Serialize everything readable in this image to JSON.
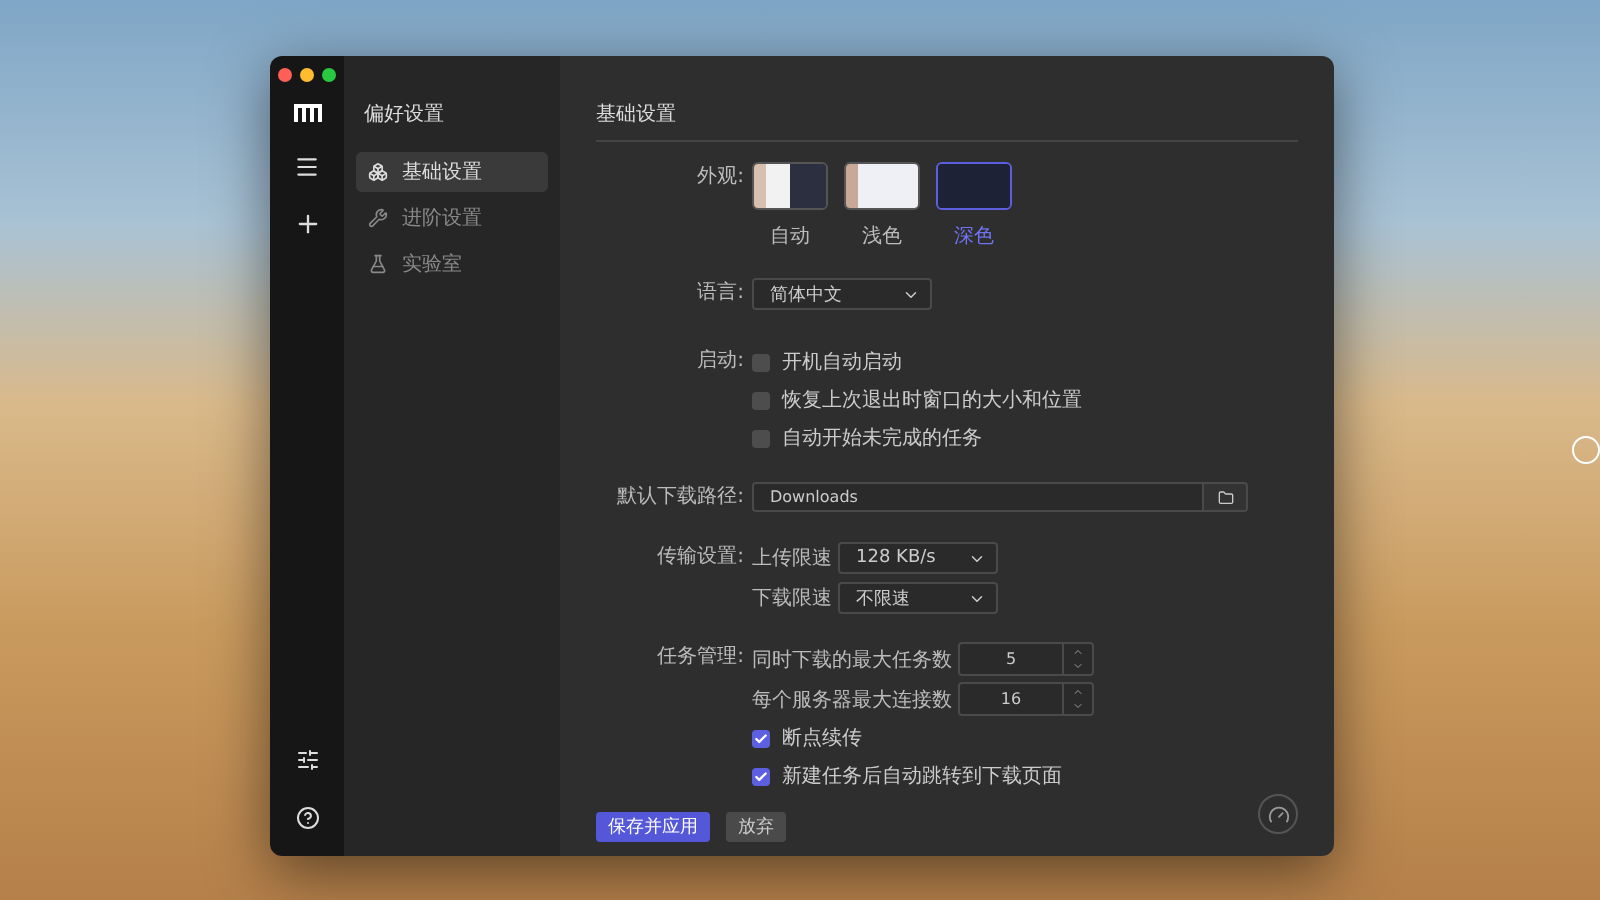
{
  "sidebar": {
    "title": "偏好设置",
    "items": [
      {
        "label": "基础设置",
        "selected": true
      },
      {
        "label": "进阶设置",
        "selected": false
      },
      {
        "label": "实验室",
        "selected": false
      }
    ]
  },
  "main": {
    "title": "基础设置",
    "appearance": {
      "label": "外观:",
      "themes": [
        {
          "kind": "auto",
          "label": "自动",
          "selected": false
        },
        {
          "kind": "light",
          "label": "浅色",
          "selected": false
        },
        {
          "kind": "dark",
          "label": "深色",
          "selected": true
        }
      ]
    },
    "language": {
      "label": "语言:",
      "value": "简体中文"
    },
    "startup": {
      "label": "启动:",
      "options": [
        {
          "label": "开机自动启动",
          "checked": false
        },
        {
          "label": "恢复上次退出时窗口的大小和位置",
          "checked": false
        },
        {
          "label": "自动开始未完成的任务",
          "checked": false
        }
      ]
    },
    "download_path": {
      "label": "默认下载路径:",
      "value": "Downloads"
    },
    "transfer": {
      "label": "传输设置:",
      "limits": [
        {
          "label": "上传限速",
          "value": "128 KB/s"
        },
        {
          "label": "下载限速",
          "value": "不限速"
        }
      ]
    },
    "tasks": {
      "label": "任务管理:",
      "numbers": [
        {
          "label": "同时下载的最大任务数",
          "value": "5"
        },
        {
          "label": "每个服务器最大连接数",
          "value": "16"
        }
      ],
      "options": [
        {
          "label": "断点续传",
          "checked": true
        },
        {
          "label": "新建任务后自动跳转到下载页面",
          "checked": true
        }
      ]
    },
    "buttons": [
      {
        "kind": "primary",
        "label": "保存并应用"
      },
      {
        "kind": "secondary",
        "label": "放弃"
      }
    ]
  }
}
